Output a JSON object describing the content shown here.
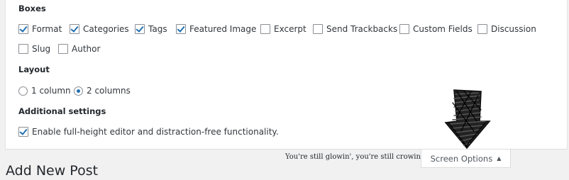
{
  "boxes": {
    "heading": "Boxes",
    "items": [
      {
        "label": "Format",
        "checked": true
      },
      {
        "label": "Categories",
        "checked": true
      },
      {
        "label": "Tags",
        "checked": true
      },
      {
        "label": "Featured Image",
        "checked": true
      },
      {
        "label": "Excerpt",
        "checked": false
      },
      {
        "label": "Send Trackbacks",
        "checked": false
      },
      {
        "label": "Custom Fields",
        "checked": false
      },
      {
        "label": "Discussion",
        "checked": false
      },
      {
        "label": "Slug",
        "checked": false
      },
      {
        "label": "Author",
        "checked": false
      }
    ]
  },
  "layout": {
    "heading": "Layout",
    "options": [
      {
        "label": "1 column",
        "selected": false
      },
      {
        "label": "2 columns",
        "selected": true
      }
    ]
  },
  "additional": {
    "heading": "Additional settings",
    "option": {
      "label": "Enable full-height editor and distraction-free functionality.",
      "checked": true
    }
  },
  "tagline": "You're still glowin', you're still crowin'",
  "screen_options": {
    "label": "Screen Options",
    "icon": "triangle-up-icon"
  },
  "page_title": "Add New Post",
  "colors": {
    "accent": "#2271b1",
    "background": "#f1f1f1",
    "panel": "#ffffff"
  }
}
